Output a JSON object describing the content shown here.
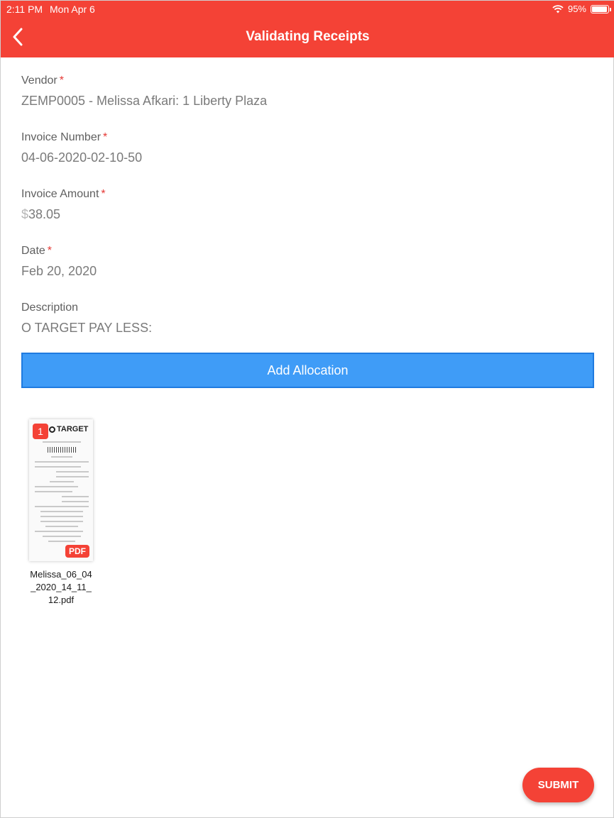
{
  "status_bar": {
    "time": "2:11 PM",
    "date": "Mon Apr 6",
    "battery": "95%",
    "battery_level": 0.95
  },
  "header": {
    "title": "Validating Receipts",
    "back_icon": "chevron-left-icon"
  },
  "fields": {
    "vendor": {
      "label": "Vendor",
      "required_mark": "*",
      "value": "ZEMP0005 - Melissa Afkari: 1 Liberty Plaza"
    },
    "invoice_number": {
      "label": "Invoice Number",
      "required_mark": "*",
      "value": "04-06-2020-02-10-50"
    },
    "invoice_amount": {
      "label": "Invoice Amount",
      "required_mark": "*",
      "currency": "$",
      "value": "38.05"
    },
    "date": {
      "label": "Date",
      "required_mark": "*",
      "value": "Feb 20, 2020"
    },
    "description": {
      "label": "Description",
      "value": "O TARGET PAY LESS:"
    }
  },
  "add_allocation_label": "Add Allocation",
  "attachment": {
    "page_number": "1",
    "type_badge": "PDF",
    "logo_text": "TARGET",
    "filename": "Melissa_06_04_2020_14_11_12.pdf"
  },
  "submit_label": "SUBMIT",
  "colors": {
    "accent_red": "#f44236",
    "button_blue": "#3f9cf7",
    "required_red": "#e53935"
  }
}
